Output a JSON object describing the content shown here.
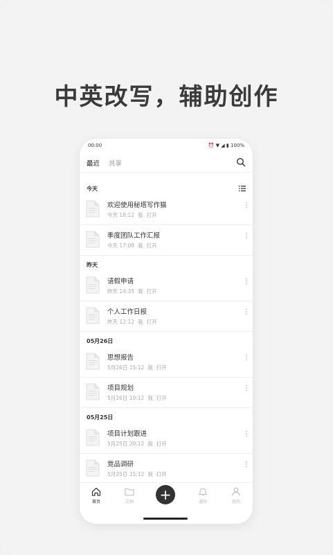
{
  "headline": "中英改写，辅助创作",
  "status_bar": {
    "time": "00:00",
    "battery": "100%"
  },
  "tabs": {
    "recent": "最近",
    "shared": "共享"
  },
  "sections": [
    {
      "label": "今天",
      "items": [
        {
          "title": "欢迎使用秘塔写作猫",
          "time": "今天 18:12",
          "owner": "我",
          "action": "打开"
        },
        {
          "title": "季度团队工作汇报",
          "time": "今天 17:08",
          "owner": "我",
          "action": "打开"
        }
      ]
    },
    {
      "label": "昨天",
      "items": [
        {
          "title": "请假申请",
          "time": "昨天 14:35",
          "owner": "我",
          "action": "打开"
        },
        {
          "title": "个人工作日报",
          "time": "昨天 12:12",
          "owner": "我",
          "action": "打开"
        }
      ]
    },
    {
      "label": "05月26日",
      "items": [
        {
          "title": "思想报告",
          "time": "5月26日 15:12",
          "owner": "我",
          "action": "打开"
        },
        {
          "title": "项目规划",
          "time": "5月26日 10:12",
          "owner": "我",
          "action": "打开"
        }
      ]
    },
    {
      "label": "05月25日",
      "items": [
        {
          "title": "项目计划跟进",
          "time": "5月25日 20:12",
          "owner": "我",
          "action": "打开"
        },
        {
          "title": "竞品调研",
          "time": "5月25日 15:12",
          "owner": "我",
          "action": "打开"
        }
      ]
    }
  ],
  "bottom_nav": {
    "home": "首页",
    "files": "文档",
    "notifications": "通知",
    "me": "我的"
  },
  "icons": {
    "search": "search-icon",
    "list": "list-view-icon",
    "doc": "document-icon",
    "more": "more-vertical-icon",
    "add": "add-icon"
  }
}
